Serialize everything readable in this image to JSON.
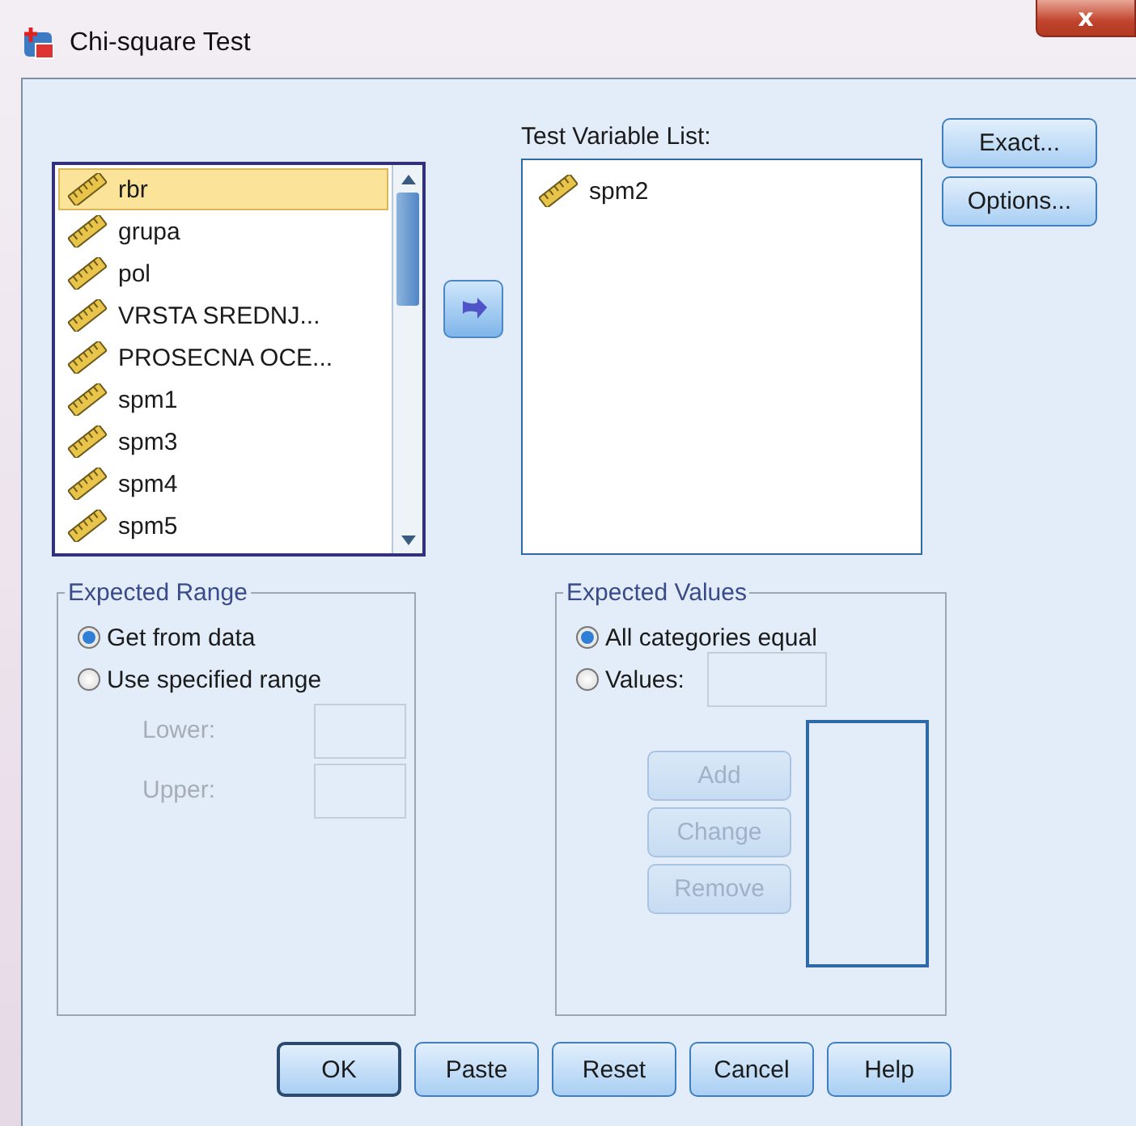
{
  "window": {
    "title": "Chi-square Test",
    "close": "x"
  },
  "source_list": {
    "items": [
      {
        "name": "rbr",
        "selected": true
      },
      {
        "name": "grupa",
        "selected": false
      },
      {
        "name": "pol",
        "selected": false
      },
      {
        "name": "VRSTA SREDNJ...",
        "selected": false
      },
      {
        "name": "PROSECNA OCE...",
        "selected": false
      },
      {
        "name": "spm1",
        "selected": false
      },
      {
        "name": "spm3",
        "selected": false
      },
      {
        "name": "spm4",
        "selected": false
      },
      {
        "name": "spm5",
        "selected": false
      }
    ]
  },
  "test_variables": {
    "label": "Test Variable List:",
    "items": [
      {
        "name": "spm2",
        "selected": false
      }
    ]
  },
  "side_buttons": [
    {
      "label": "Exact..."
    },
    {
      "label": "Options..."
    }
  ],
  "expected_range": {
    "title": "Expected Range",
    "options": [
      {
        "label": "Get from data",
        "selected": true
      },
      {
        "label": "Use specified range",
        "selected": false
      }
    ],
    "fields": [
      {
        "label": "Lower:",
        "disabled": true
      },
      {
        "label": "Upper:",
        "disabled": true
      }
    ]
  },
  "expected_values": {
    "title": "Expected Values",
    "options": [
      {
        "label": "All categories equal",
        "selected": true
      },
      {
        "label": "Values:",
        "selected": false
      }
    ],
    "buttons": [
      {
        "label": "Add",
        "disabled": true
      },
      {
        "label": "Change",
        "disabled": true
      },
      {
        "label": "Remove",
        "disabled": true
      }
    ]
  },
  "footer_buttons": [
    {
      "label": "OK",
      "default": true
    },
    {
      "label": "Paste",
      "default": false
    },
    {
      "label": "Reset",
      "default": false
    },
    {
      "label": "Cancel",
      "default": false
    },
    {
      "label": "Help",
      "default": false
    }
  ]
}
